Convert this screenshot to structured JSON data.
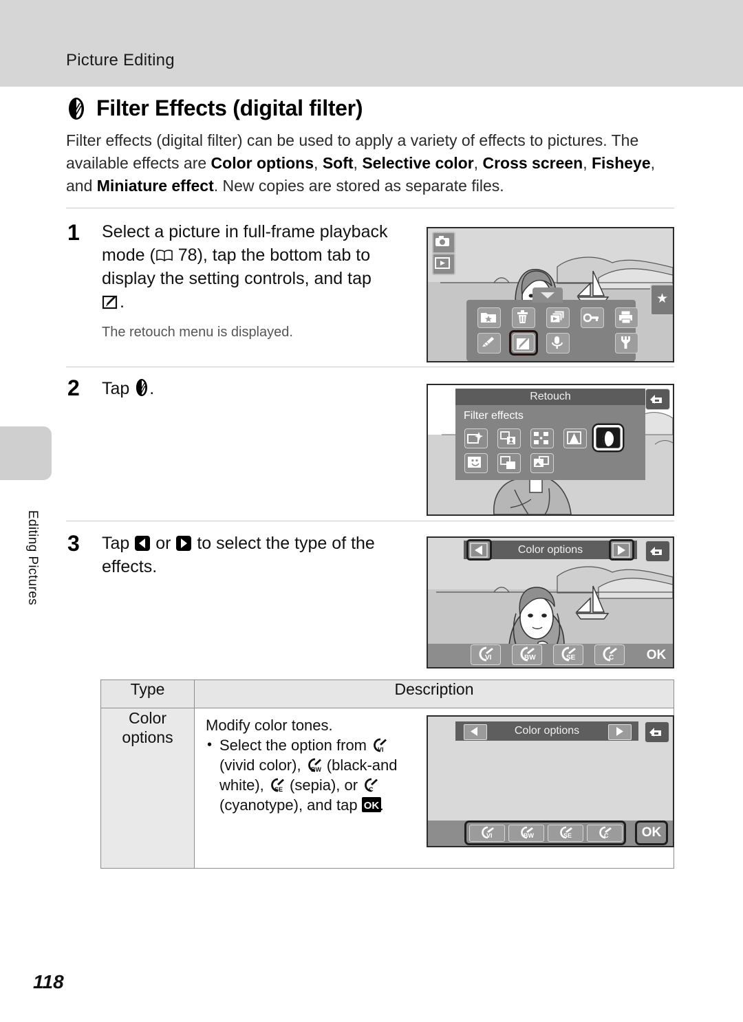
{
  "header": {
    "running_head": "Picture Editing"
  },
  "side_tab": {
    "label": "Editing Pictures"
  },
  "section": {
    "icon": "filter-effects-icon",
    "title": "Filter Effects (digital filter)",
    "intro_1": "Filter effects (digital filter) can be used to apply a variety of effects to pictures. The available effects are ",
    "intro_b1": "Color options",
    "intro_sep1": ", ",
    "intro_b2": "Soft",
    "intro_sep2": ", ",
    "intro_b3": "Selective color",
    "intro_sep3": ", ",
    "intro_b4": "Cross screen",
    "intro_sep4": ", ",
    "intro_b5": "Fisheye",
    "intro_sep5": ", and ",
    "intro_b6": "Miniature effect",
    "intro_2": ". New copies are stored as separate files."
  },
  "steps": [
    {
      "num": "1",
      "text_a": "Select a picture in full-frame playback mode (",
      "ref": "78",
      "text_b": "), tap the bottom tab to display the setting controls, and tap ",
      "text_c": ".",
      "note": "The retouch menu is displayed."
    },
    {
      "num": "2",
      "text_a": "Tap ",
      "text_c": "."
    },
    {
      "num": "3",
      "text_a": "Tap ",
      "text_mid": " or ",
      "text_b": " to select the type of the effects."
    }
  ],
  "screens": {
    "screen1": {
      "name": "playback-setting-controls",
      "tab_star": "★",
      "icons": [
        "favorites-icon",
        "delete-icon",
        "slideshow-icon",
        "protect-icon",
        "print-icon",
        "paint-icon",
        "retouch-icon",
        "voice-memo-icon",
        "setup-icon"
      ],
      "highlighted": "retouch-icon"
    },
    "screen2": {
      "name": "retouch-menu",
      "title": "Retouch",
      "subtitle": "Filter effects",
      "back_icon": "back-arrow-icon",
      "highlighted": "filter-effects-icon"
    },
    "screen3": {
      "name": "color-options-preview",
      "title": "Color options",
      "left_icon": "left-arrow-icon",
      "right_icon": "right-arrow-icon",
      "back_icon": "back-arrow-icon",
      "buttons": [
        "VI",
        "BW",
        "SE",
        "C"
      ],
      "ok_label": "OK"
    },
    "screen4": {
      "name": "color-options-table-preview",
      "title": "Color options",
      "left_icon": "left-arrow-icon",
      "right_icon": "right-arrow-icon",
      "back_icon": "back-arrow-icon",
      "buttons": [
        "VI",
        "BW",
        "SE",
        "C"
      ],
      "ok_label": "OK"
    }
  },
  "table": {
    "headers": {
      "type": "Type",
      "description": "Description"
    },
    "rows": [
      {
        "type": "Color options",
        "desc_line1": "Modify color tones.",
        "desc_b_a": "Select the option from ",
        "desc_b_b": " (vivid color), ",
        "desc_b_c": " (black-and white), ",
        "desc_b_d": " (sepia), or ",
        "desc_b_e": " (cyanotype), and tap ",
        "desc_b_f": "."
      }
    ]
  },
  "page_number": "118",
  "colors": {
    "header_band": "#d6d6d6",
    "screen_bg": "#d9d9d9",
    "panel_gray": "#6e6e6e",
    "title_bar": "#5e5e5e"
  }
}
